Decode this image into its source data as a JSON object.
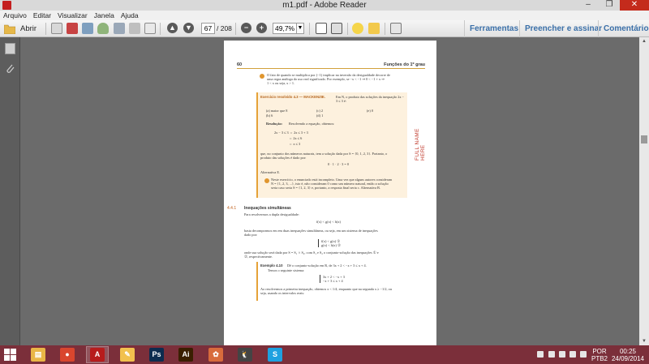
{
  "window": {
    "title": "m1.pdf - Adobe Reader",
    "minimize": "–",
    "restore": "❐",
    "close": "✕"
  },
  "menu": [
    "Arquivo",
    "Editar",
    "Visualizar",
    "Janela",
    "Ajuda"
  ],
  "toolbar": {
    "open_label": "Abrir",
    "page_current": "67",
    "page_total": "/ 208",
    "zoom_value": "49,7%",
    "zoom_arrow": "▼",
    "zoom_out": "−",
    "zoom_in": "+",
    "prev_page": "▲",
    "next_page": "▼",
    "right_links": [
      "Ferramentas",
      "Preencher e assinar",
      "Comentário"
    ]
  },
  "document": {
    "page_number": "60",
    "chapter_title": "Funções do 1º grau",
    "note1": [
      "O fato de quando se multiplica por (−1) implicar na inversão da desigualdade decorre de",
      "uma regra análoga do uso real significado. Por exemplo, se −x < −1 ⇒ 0 < −1 + x ⇒",
      "1 < x ou seja, x > 1."
    ],
    "exercise_title": "Exercício resolvido 4.3 — MACKENZIE.",
    "exercise_intro": "Em N, o produto das soluções da inequação 2x − 3 ≤ 3 é:",
    "options": [
      "(a)  maior que 8",
      "(c)  2",
      "(e)  0",
      "(b)  6",
      "(d)  1"
    ],
    "resolution_label": "Resolução:",
    "resolution_text": "Resolvendo a equação, obtemos:",
    "steps": [
      "2x − 3 ≤ 3 ⇔ 2x ≤ 3 + 3",
      "⇔ 2x ≤ 6",
      "⇔ x ≤ 3"
    ],
    "conclusion": [
      "que, no conjunto dos números naturais, tem a solução dada por S = {0, 1, 2, 3}. Portanto, o",
      "produto das soluções é dado por:"
    ],
    "product": "0 · 1 · 2 · 3 = 0",
    "answer": "Alternativa E.",
    "note2": [
      "Neste exercício, o enunciado está incompleto. Uma vez que alguns autores consideram",
      "N = {1, 2, 3, ...}, isto é, não consideram 0 como um número natural, então a solução",
      "seria caso seria S = {1, 2, 3} e, portanto, a resposta final seria c. Alternativa B."
    ],
    "section_number": "4.4.1",
    "section_title": "Inequações simultâneas",
    "section_intro": "Para resolvermos a dupla desigualdade:",
    "double_ineq": "f(x) < g(x) < h(x)",
    "decompose": [
      "basta decompormos em em duas inequações simultâneas, ou seja, em um sistema de inequações",
      "dado por:"
    ],
    "system": [
      "f(x) < g(x)   ①",
      "g(x) < h(x)   ②"
    ],
    "solution_line": [
      "onde sua solução será dada por S = S₁ ∩ S₂, com S₁ e S₂ o conjunto-solução das inequações ① e",
      "②, respectivamente."
    ],
    "example_title": "Exemplo 4.10",
    "example_intro": "Dê o conjunto-solução em R, de 3x + 2 < −x + 3 ≤ x + 4.",
    "example_sub": "Temos o seguinte sistema:",
    "example_system": [
      "3x + 2 < −x + 3",
      "−x + 3 ≤ x + 4"
    ],
    "example_end": [
      "Ao resolvermos a primeira inequação, obtemos x < 1/4, enquanto que na segunda x ≥ −1/2, ou",
      "seja, usando os intervalos reais:"
    ],
    "side_text": "FULL NAME HERE"
  },
  "taskbar": {
    "apps": [
      {
        "name": "explorer",
        "color": "#e9b646",
        "glyph": "▤"
      },
      {
        "name": "chrome",
        "color": "#d9462e",
        "glyph": "●"
      },
      {
        "name": "adobe-reader",
        "color": "#b71c1c",
        "glyph": "A"
      },
      {
        "name": "notepad",
        "color": "#f2c14e",
        "glyph": "✎"
      },
      {
        "name": "photoshop",
        "color": "#0d2c4f",
        "glyph": "Ps"
      },
      {
        "name": "illustrator",
        "color": "#3a1f00",
        "glyph": "Ai"
      },
      {
        "name": "paint",
        "color": "#d86b3c",
        "glyph": "✿"
      },
      {
        "name": "linux-vm",
        "color": "#444444",
        "glyph": "🐧"
      },
      {
        "name": "skype",
        "color": "#1ea1e0",
        "glyph": "S"
      }
    ],
    "language": "POR",
    "layout": "PTB2",
    "time": "00:25",
    "date": "24/09/2014"
  }
}
